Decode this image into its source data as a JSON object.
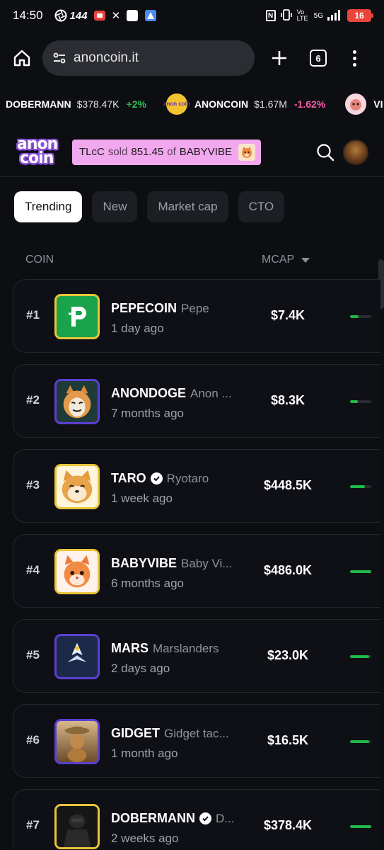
{
  "status_bar": {
    "time": "14:50",
    "refresh_rate": "144",
    "network": "5G",
    "volte": "Vo LTE",
    "battery": "16"
  },
  "browser": {
    "url": "anoncoin.it",
    "tab_count": "6"
  },
  "ticker": [
    {
      "symbol": "DOBERMANN",
      "price": "$378.47K",
      "change": "+2%",
      "direction": "up"
    },
    {
      "symbol": "ANONCOIN",
      "price": "$1.67M",
      "change": "-1.62%",
      "direction": "down",
      "logo_text": "anon coin"
    },
    {
      "symbol": "VI",
      "price": "",
      "change": "",
      "direction": "none"
    }
  ],
  "header": {
    "brand_line1": "anon",
    "brand_line2": "coin",
    "sold_banner": {
      "user": "TLcC",
      "verb": "sold",
      "amount": "851.45",
      "of": "of",
      "coin": "BABYVIBE"
    }
  },
  "filters": {
    "tabs": [
      {
        "label": "Trending",
        "active": true
      },
      {
        "label": "New",
        "active": false
      },
      {
        "label": "Market cap",
        "active": false
      },
      {
        "label": "CTO",
        "active": false
      }
    ]
  },
  "table": {
    "col_coin": "COIN",
    "col_mcap": "MCAP",
    "rows": [
      {
        "rank": "#1",
        "symbol": "PEPECOIN",
        "name": "Pepe",
        "age": "1 day ago",
        "mcap": "$7.4K",
        "verified": false,
        "bar": 0.4
      },
      {
        "rank": "#2",
        "symbol": "ANONDOGE",
        "name": "Anon ...",
        "age": "7 months ago",
        "mcap": "$8.3K",
        "verified": false,
        "bar": 0.35
      },
      {
        "rank": "#3",
        "symbol": "TARO",
        "name": "Ryotaro",
        "age": "1 week ago",
        "mcap": "$448.5K",
        "verified": true,
        "bar": 0.7
      },
      {
        "rank": "#4",
        "symbol": "BABYVIBE",
        "name": "Baby Vi...",
        "age": "6 months ago",
        "mcap": "$486.0K",
        "verified": false,
        "bar": 1.0
      },
      {
        "rank": "#5",
        "symbol": "MARS",
        "name": "Marslanders",
        "age": "2 days ago",
        "mcap": "$23.0K",
        "verified": false,
        "bar": 0.9
      },
      {
        "rank": "#6",
        "symbol": "GIDGET",
        "name": "Gidget tac...",
        "age": "1 month ago",
        "mcap": "$16.5K",
        "verified": false,
        "bar": 0.9
      },
      {
        "rank": "#7",
        "symbol": "DOBERMANN",
        "name": "D...",
        "age": "2 weeks ago",
        "mcap": "$378.4K",
        "verified": true,
        "bar": 1.0
      }
    ]
  },
  "colors": {
    "accent_green": "#1fb84a",
    "accent_pink": "#f2a8ef",
    "down_pink": "#ff5ca8",
    "thumb_gold": "#e9c43a",
    "thumb_purple": "#5b3fd4"
  }
}
